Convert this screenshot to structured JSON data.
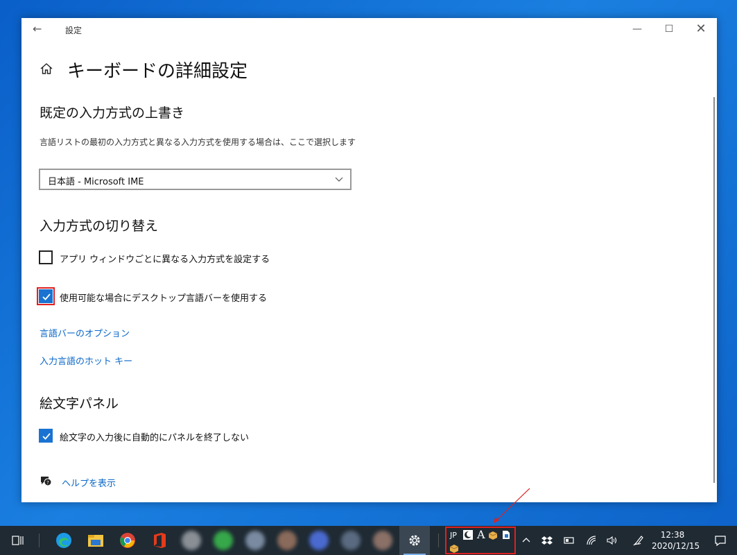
{
  "window": {
    "app_title": "設定",
    "page_title": "キーボードの詳細設定"
  },
  "override": {
    "title": "既定の入力方式の上書き",
    "description": "言語リストの最初の入力方式と異なる入力方式を使用する場合は、ここで選択します",
    "select_value": "日本語 - Microsoft IME"
  },
  "switching": {
    "title": "入力方式の切り替え",
    "per_app_label": "アプリ ウィンドウごとに異なる入力方式を設定する",
    "per_app_checked": false,
    "desktop_bar_label": "使用可能な場合にデスクトップ言語バーを使用する",
    "desktop_bar_checked": true,
    "langbar_options_link": "言語バーのオプション",
    "hotkeys_link": "入力言語のホット キー"
  },
  "emoji": {
    "title": "絵文字パネル",
    "keep_open_label": "絵文字の入力後に自動的にパネルを終了しない",
    "keep_open_checked": true
  },
  "help": {
    "link": "ヘルプを表示"
  },
  "taskbar": {
    "tray_lang": "JP",
    "tray_a": "A",
    "time": "12:38",
    "date": "2020/12/15"
  },
  "colors": {
    "accent": "#1a73d1",
    "link": "#0a67c8",
    "highlight": "#e02020",
    "taskbar": "#1f2a33"
  },
  "icons": [
    "back-arrow-icon",
    "home-icon",
    "chevron-down-icon",
    "checkmark-icon",
    "help-icon",
    "task-view-icon",
    "edge-icon",
    "explorer-icon",
    "chrome-icon",
    "office-icon",
    "gear-icon",
    "moon-icon",
    "package-icon",
    "document-icon",
    "chevron-up-icon",
    "dropbox-icon",
    "battery-icon",
    "wifi-icon",
    "volume-icon",
    "pen-icon",
    "notification-icon"
  ]
}
